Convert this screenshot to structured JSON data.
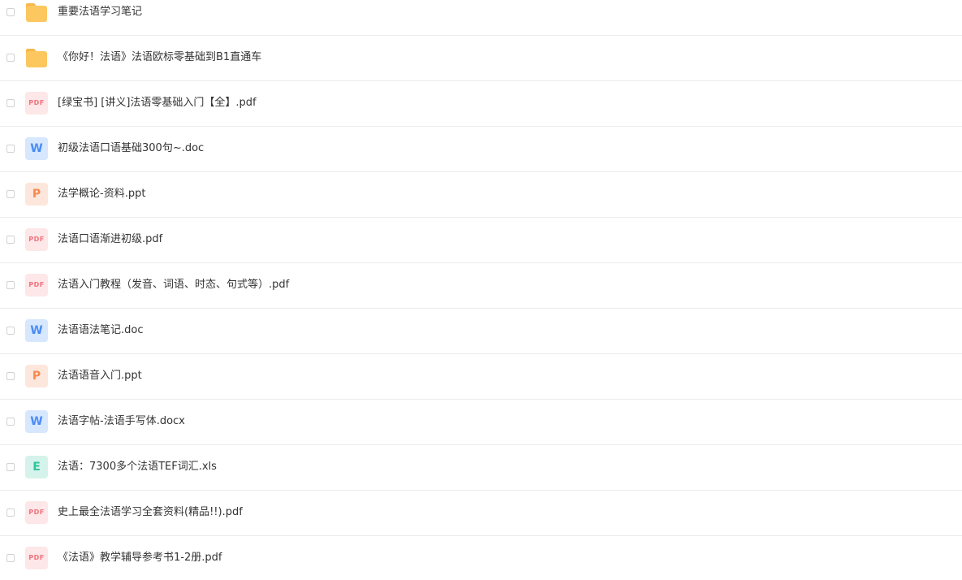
{
  "files": [
    {
      "name": "重要法语学习笔记",
      "icon": "folder-icon",
      "type": "folder"
    },
    {
      "name": "《你好！法语》法语欧标零基础到B1直通车",
      "icon": "folder-icon",
      "type": "folder"
    },
    {
      "name": "[绿宝书] [讲义]法语零基础入门【全】.pdf",
      "icon": "pdf-icon",
      "type": "pdf",
      "glyph": "PDF"
    },
    {
      "name": "初级法语口语基础300句~.doc",
      "icon": "word-icon",
      "type": "word",
      "glyph": "W"
    },
    {
      "name": "法学概论-资料.ppt",
      "icon": "ppt-icon",
      "type": "ppt",
      "glyph": "P"
    },
    {
      "name": "法语口语渐进初级.pdf",
      "icon": "pdf-icon",
      "type": "pdf",
      "glyph": "PDF"
    },
    {
      "name": "法语入门教程（发音、词语、时态、句式等）.pdf",
      "icon": "pdf-icon",
      "type": "pdf",
      "glyph": "PDF"
    },
    {
      "name": "法语语法笔记.doc",
      "icon": "word-icon",
      "type": "word",
      "glyph": "W"
    },
    {
      "name": "法语语音入门.ppt",
      "icon": "ppt-icon",
      "type": "ppt",
      "glyph": "P"
    },
    {
      "name": "法语字帖-法语手写体.docx",
      "icon": "word-icon",
      "type": "word",
      "glyph": "W"
    },
    {
      "name": "法语：7300多个法语TEF词汇.xls",
      "icon": "excel-icon",
      "type": "excel",
      "glyph": "E"
    },
    {
      "name": "史上最全法语学习全套资料(精品!!).pdf",
      "icon": "pdf-icon",
      "type": "pdf",
      "glyph": "PDF"
    },
    {
      "name": "《法语》教学辅导参考书1-2册.pdf",
      "icon": "pdf-icon",
      "type": "pdf",
      "glyph": "PDF"
    }
  ],
  "colors": {
    "folder": "#fcc75e",
    "pdf": "#f2727c",
    "word": "#4a8cf7",
    "ppt": "#f6894f",
    "excel": "#2fc4a0",
    "divider": "#ebebeb",
    "text": "#333333"
  }
}
